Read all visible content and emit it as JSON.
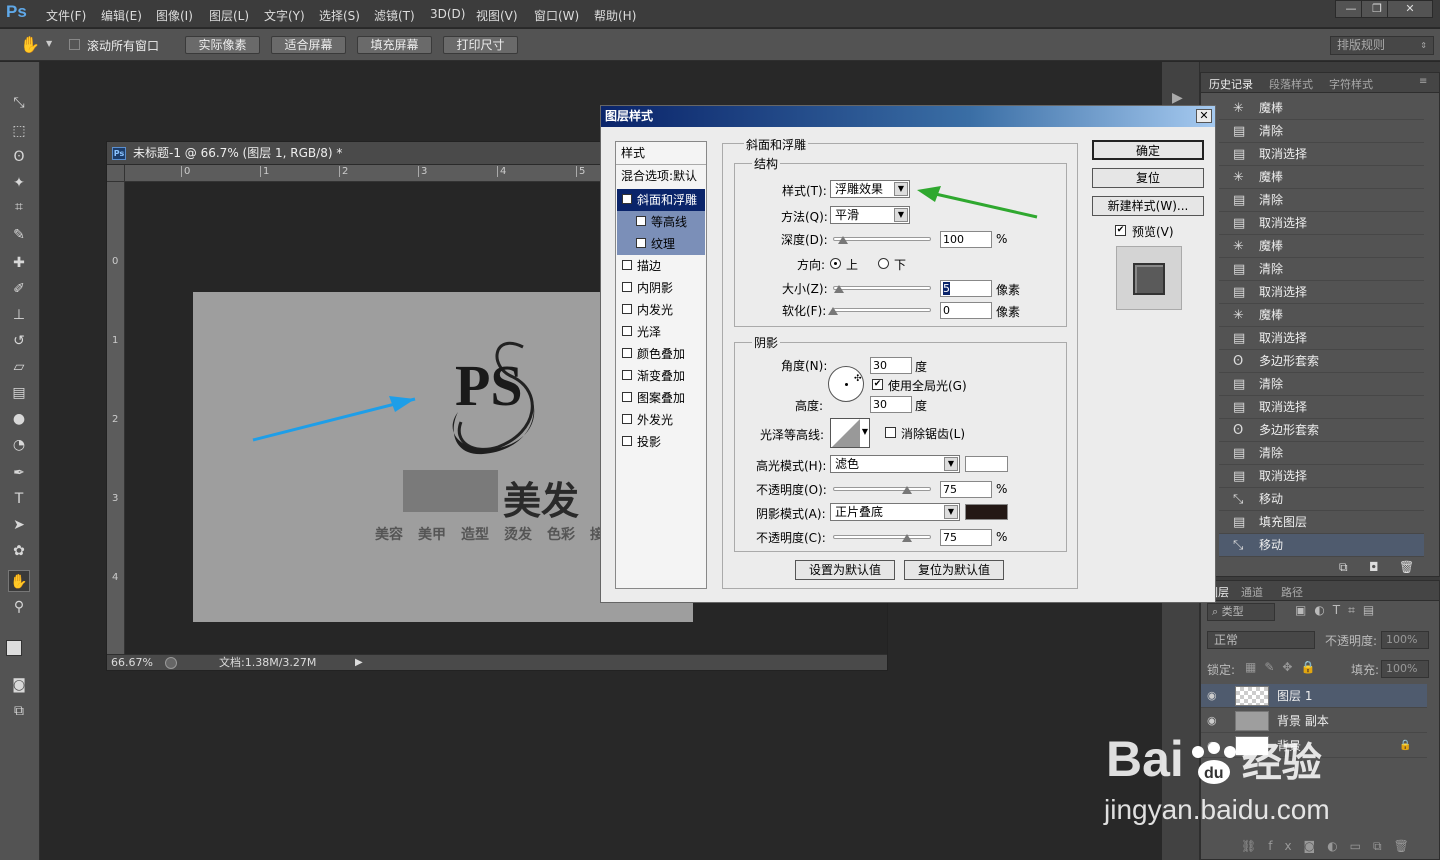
{
  "app": {
    "logo": "Ps"
  },
  "menubar": {
    "items": [
      "文件(F)",
      "编辑(E)",
      "图像(I)",
      "图层(L)",
      "文字(Y)",
      "选择(S)",
      "滤镜(T)",
      "3D(D)",
      "视图(V)",
      "窗口(W)",
      "帮助(H)"
    ]
  },
  "optionsbar": {
    "scroll_all": "滚动所有窗口",
    "actual_pixels": "实际像素",
    "fit_screen": "适合屏幕",
    "fill_screen": "填充屏幕",
    "print_size": "打印尺寸",
    "workspace": "排版规则"
  },
  "document": {
    "title": "未标题-1 @ 66.7% (图层 1, RGB/8) *",
    "zoom": "66.67%",
    "doc_size": "文档:1.38M/3.27M",
    "ruler_h": [
      "0",
      "1",
      "2",
      "3",
      "4",
      "5"
    ],
    "ruler_v": [
      "0",
      "1",
      "2",
      "3",
      "4"
    ],
    "logo_text": "PS",
    "brand_name": "美发",
    "tagline": [
      "美容",
      "美甲",
      "造型",
      "烫发",
      "色彩",
      "接发"
    ]
  },
  "history": {
    "tabs": [
      "历史记录",
      "段落样式",
      "字符样式"
    ],
    "items": [
      {
        "icon": "magic-wand-icon",
        "label": "魔棒"
      },
      {
        "icon": "document-icon",
        "label": "清除"
      },
      {
        "icon": "document-icon",
        "label": "取消选择"
      },
      {
        "icon": "magic-wand-icon",
        "label": "魔棒"
      },
      {
        "icon": "document-icon",
        "label": "清除"
      },
      {
        "icon": "document-icon",
        "label": "取消选择"
      },
      {
        "icon": "magic-wand-icon",
        "label": "魔棒"
      },
      {
        "icon": "document-icon",
        "label": "清除"
      },
      {
        "icon": "document-icon",
        "label": "取消选择"
      },
      {
        "icon": "magic-wand-icon",
        "label": "魔棒"
      },
      {
        "icon": "document-icon",
        "label": "取消选择"
      },
      {
        "icon": "polygon-lasso-icon",
        "label": "多边形套索"
      },
      {
        "icon": "document-icon",
        "label": "清除"
      },
      {
        "icon": "document-icon",
        "label": "取消选择"
      },
      {
        "icon": "polygon-lasso-icon",
        "label": "多边形套索"
      },
      {
        "icon": "document-icon",
        "label": "清除"
      },
      {
        "icon": "document-icon",
        "label": "取消选择"
      },
      {
        "icon": "move-icon",
        "label": "移动"
      },
      {
        "icon": "document-icon",
        "label": "填充图层"
      },
      {
        "icon": "move-icon",
        "label": "移动"
      }
    ]
  },
  "layers": {
    "tabs": [
      "图层",
      "通道",
      "路径"
    ],
    "filter": "类型",
    "blend": "正常",
    "opacity_label": "不透明度:",
    "opacity": "100%",
    "lock_label": "锁定:",
    "fill_label": "填充:",
    "fill": "100%",
    "items": [
      "图层 1",
      "背景 副本",
      "背景"
    ]
  },
  "dialog": {
    "title": "图层样式",
    "styles_header": "样式",
    "blend_options": "混合选项:默认",
    "styles": [
      {
        "label": "斜面和浮雕",
        "checked": true,
        "selected": true
      },
      {
        "label": "等高线",
        "checked": false,
        "sub": true
      },
      {
        "label": "纹理",
        "checked": false,
        "sub": true
      },
      {
        "label": "描边",
        "checked": false
      },
      {
        "label": "内阴影",
        "checked": false
      },
      {
        "label": "内发光",
        "checked": false
      },
      {
        "label": "光泽",
        "checked": false
      },
      {
        "label": "颜色叠加",
        "checked": false
      },
      {
        "label": "渐变叠加",
        "checked": false
      },
      {
        "label": "图案叠加",
        "checked": false
      },
      {
        "label": "外发光",
        "checked": false
      },
      {
        "label": "投影",
        "checked": false
      }
    ],
    "bevel_title": "斜面和浮雕",
    "structure_title": "结构",
    "style_label": "样式(T):",
    "style_value": "浮雕效果",
    "technique_label": "方法(Q):",
    "technique_value": "平滑",
    "depth_label": "深度(D):",
    "depth_value": "100",
    "percent": "%",
    "direction_label": "方向:",
    "dir_up": "上",
    "dir_down": "下",
    "size_label": "大小(Z):",
    "size_value": "5",
    "px": "像素",
    "soften_label": "软化(F):",
    "soften_value": "0",
    "shading_title": "阴影",
    "angle_label": "角度(N):",
    "angle_value": "30",
    "degree": "度",
    "global_light": "使用全局光(G)",
    "altitude_label": "高度:",
    "altitude_value": "30",
    "gloss_label": "光泽等高线:",
    "antialias": "消除锯齿(L)",
    "highlight_label": "高光模式(H):",
    "highlight_value": "滤色",
    "highlight_color": "#ffffff",
    "hl_opacity_label": "不透明度(O):",
    "hl_opacity_value": "75",
    "shadow_label": "阴影模式(A):",
    "shadow_value": "正片叠底",
    "shadow_color": "#231815",
    "sh_opacity_label": "不透明度(C):",
    "sh_opacity_value": "75",
    "set_default": "设置为默认值",
    "reset_default": "复位为默认值",
    "ok": "确定",
    "reset": "复位",
    "new_style": "新建样式(W)...",
    "preview": "预览(V)"
  },
  "watermark": {
    "brand": "Bai",
    "brand2": "经验",
    "url": "jingyan.baidu.com"
  }
}
